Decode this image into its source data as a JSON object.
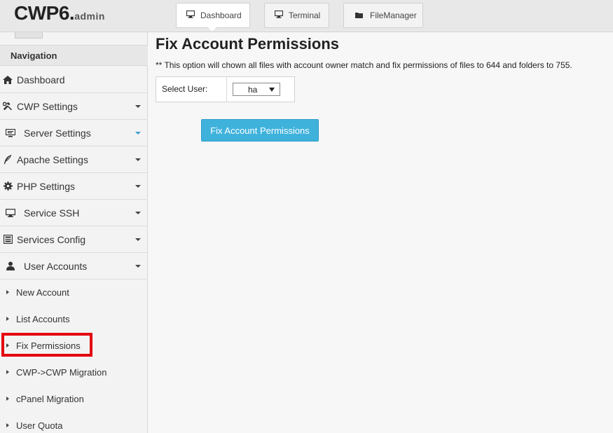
{
  "header": {
    "logo_main": "CWP6.",
    "logo_sub": "admin",
    "tabs": [
      {
        "label": "Dashboard",
        "icon": "monitor-icon"
      },
      {
        "label": "Terminal",
        "icon": "monitor-icon"
      },
      {
        "label": "FileManager",
        "icon": "folder-icon"
      }
    ]
  },
  "sidebar": {
    "nav_title": "Navigation",
    "items": [
      {
        "label": "Dashboard",
        "icon": "home-icon"
      },
      {
        "label": "CWP Settings",
        "icon": "tools-icon"
      },
      {
        "label": "Server Settings",
        "icon": "server-icon"
      },
      {
        "label": "Apache Settings",
        "icon": "feather-icon"
      },
      {
        "label": "PHP Settings",
        "icon": "gear-icon"
      },
      {
        "label": "Service SSH",
        "icon": "monitor-icon"
      },
      {
        "label": "Services Config",
        "icon": "hdd-icon"
      },
      {
        "label": "User Accounts",
        "icon": "user-icon"
      }
    ],
    "sub_items": [
      "New Account",
      "List Accounts",
      "Fix Permissions",
      "CWP->CWP Migration",
      "cPanel Migration",
      "User Quota"
    ],
    "highlight_color": "#e4000f"
  },
  "main": {
    "title": "Fix Account Permissions",
    "description": "** This option will chown all files with account owner match and fix permissions of files to 644 and folders to 755.",
    "select_label": "Select User:",
    "select_value": "ha",
    "button_label": "Fix Account Permissions",
    "button_color": "#3fb2dc"
  }
}
